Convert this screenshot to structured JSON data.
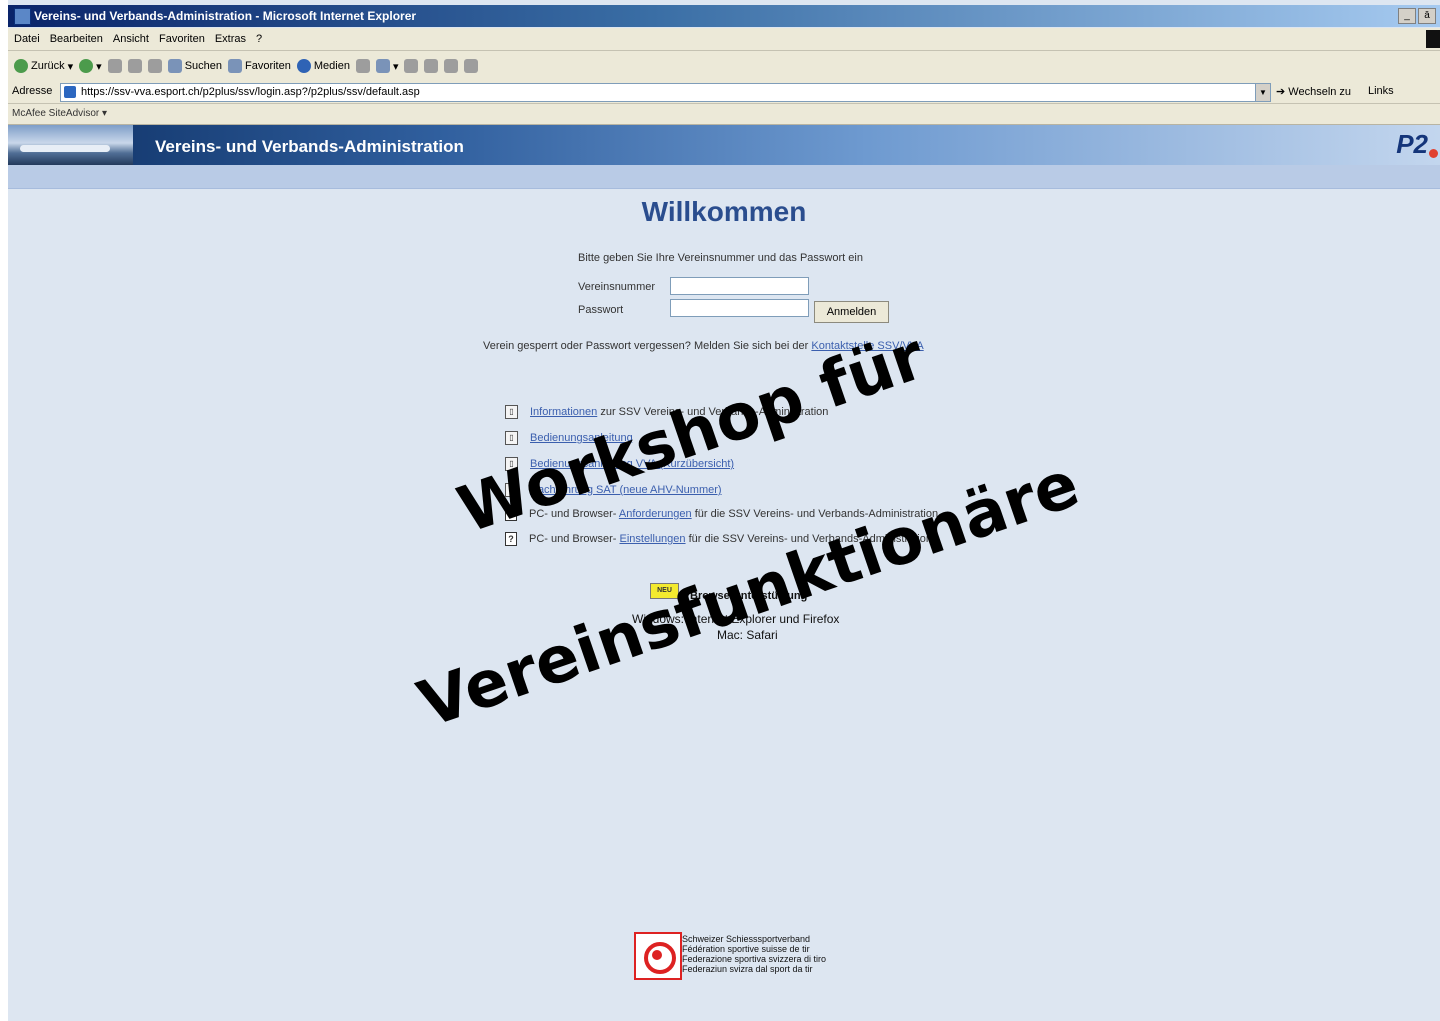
{
  "window": {
    "title": "Vereins- und Verbands-Administration - Microsoft Internet Explorer",
    "controls": [
      "_",
      "ā"
    ]
  },
  "menu": [
    "Datei",
    "Bearbeiten",
    "Ansicht",
    "Favoriten",
    "Extras",
    "?"
  ],
  "toolbar": {
    "back": "Zurück",
    "search": "Suchen",
    "favorites": "Favoriten",
    "media": "Medien"
  },
  "address": {
    "label": "Adresse",
    "url": "https://ssv-vva.esport.ch/p2plus/ssv/login.asp?/p2plus/ssv/default.asp",
    "go": "Wechseln zu",
    "links": "Links"
  },
  "mcafee": {
    "label": "McAfee SiteAdvisor"
  },
  "site": {
    "title": "Vereins- und Verbands-Administration",
    "logo": "P2"
  },
  "login": {
    "heading": "Willkommen",
    "instructions": "Bitte geben Sie Ihre Vereinsnummer und das Passwort ein",
    "vereinsnummer_label": "Vereinsnummer",
    "passwort_label": "Passwort",
    "submit": "Anmelden",
    "help_text": "Verein gesperrt oder Passwort vergessen? Melden Sie sich bei der",
    "help_link": "Kontaktstelle SSV/VVA"
  },
  "info_links": [
    {
      "icon": "book",
      "link": "Informationen",
      "rest": "zur SSV Vereins- und Verbands-Administration"
    },
    {
      "icon": "book",
      "link": "Bedienungsanleitung",
      "rest": ""
    },
    {
      "icon": "book",
      "link": "Bedienungsanleitung VVA (Kurzübersicht)",
      "rest": ""
    },
    {
      "icon": "book",
      "link": "Nachführung SAT (neue AHV-Nummer)",
      "rest": ""
    },
    {
      "icon": "help",
      "prefix": "PC- und Browser-",
      "link": "Anforderungen",
      "rest": "für die SSV Vereins- und Verbands-Administration"
    },
    {
      "icon": "help",
      "prefix": "PC- und Browser-",
      "link": "Einstellungen",
      "rest": "für die SSV Vereins- und Verbands-Administration"
    }
  ],
  "browser_support": {
    "badge": "NEU",
    "heading": "Browserunterstützung",
    "windows": "Windows: Internet Explorer und Firefox",
    "mac": "Mac: Safari"
  },
  "watermark": {
    "line1": "Workshop für",
    "line2": "Vereinsfunktionäre"
  },
  "footer": {
    "org": [
      "Schweizer Schiesssportverband",
      "Fédération sportive suisse de tir",
      "Federazione sportiva svizzera di tiro",
      "Federaziun svizra dal sport da tir"
    ]
  }
}
